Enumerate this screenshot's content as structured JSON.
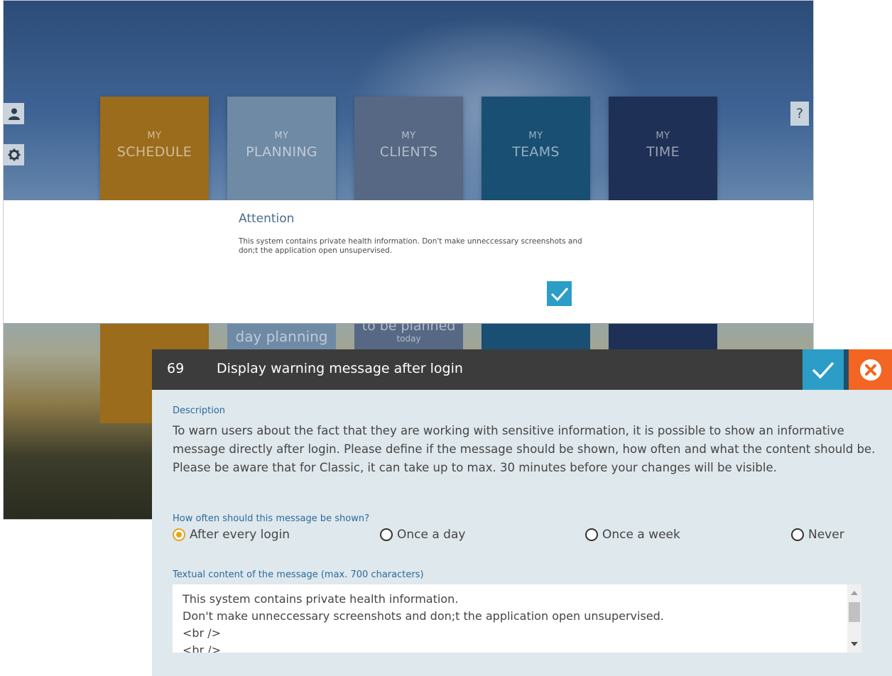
{
  "app": {
    "tiles": [
      {
        "top": "MY",
        "main": "SCHEDULE",
        "color": "#9a6c1c"
      },
      {
        "top": "MY",
        "main": "PLANNING",
        "color": "#6f8aa5"
      },
      {
        "top": "MY",
        "main": "CLIENTS",
        "color": "#566884"
      },
      {
        "top": "MY",
        "main": "TEAMS",
        "color": "#194f73"
      },
      {
        "top": "MY",
        "main": "TIME",
        "color": "#1e3055"
      }
    ],
    "lower_tiles": [
      {
        "big": "",
        "small": ""
      },
      {
        "big": "day planning",
        "small": ""
      },
      {
        "big": "to be planned",
        "small": "today"
      },
      {
        "big": "",
        "small": ""
      },
      {
        "big": "",
        "small": ""
      }
    ],
    "help_label": "?",
    "icons": {
      "user": "user-icon",
      "settings": "gear-icon"
    }
  },
  "attention": {
    "title": "Attention",
    "message": "This system contains private health information. Don't make unneccessary screenshots and don;t the application open unsupervised."
  },
  "dialog": {
    "number": "69",
    "title": "Display warning message after login",
    "description_label": "Description",
    "description": "To warn users about the fact that they are working with sensitive information, it is possible to show an informative message directly after login. Please define if the message should be shown, how often and what the content should be. Please be aware that for Classic, it can take up to max. 30 minutes before your changes will be visible.",
    "frequency_label": "How often should this message be shown?",
    "frequency_options": [
      "After every login",
      "Once a day",
      "Once a week",
      "Never"
    ],
    "frequency_selected": "After every login",
    "content_label": "Textual content of the message (max. 700 characters)",
    "content_value": "This system contains private health information.\nDon't make unneccessary screenshots and don;t the application open unsupervised.\n<br />\n<br />",
    "colors": {
      "accent": "#2b9dc6",
      "cancel": "#f26522",
      "selected": "#e8a21b",
      "label": "#2b6a9c"
    }
  }
}
